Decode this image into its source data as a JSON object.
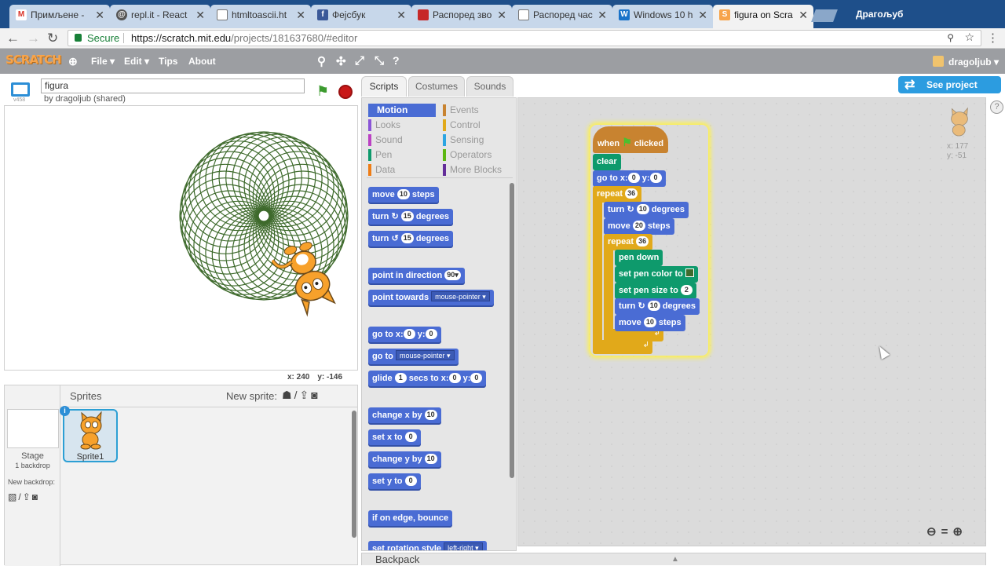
{
  "browser": {
    "tabs": [
      {
        "label": "Примљене - ",
        "icon": "gmail-icon"
      },
      {
        "label": "repl.it - React",
        "icon": "repl-icon"
      },
      {
        "label": "htmltoascii.ht",
        "icon": "document-icon"
      },
      {
        "label": "Фејсбук",
        "icon": "facebook-icon"
      },
      {
        "label": "Распоред зво",
        "icon": "page-icon"
      },
      {
        "label": "Распоред час",
        "icon": "document-icon"
      },
      {
        "label": "Windows 10 h",
        "icon": "windows-icon"
      },
      {
        "label": "figura on Scra",
        "icon": "scratch-icon"
      }
    ],
    "user": "Драгољуб",
    "secure_label": "Secure",
    "url_host": "https://scratch.mit.edu",
    "url_path": "/projects/181637680/#editor"
  },
  "menubar": {
    "logo": "SCRATCH",
    "items": [
      "File ▾",
      "Edit ▾",
      "Tips",
      "About"
    ],
    "user": "dragoljub ▾"
  },
  "stage": {
    "version": "v458",
    "title": "figura",
    "by": "by dragoljub (shared)",
    "mouse_x": "x: 240",
    "mouse_y": "y: -146"
  },
  "sprites_panel": {
    "title": "Sprites",
    "new_sprite": "New sprite:",
    "stage_label": "Stage",
    "backdrops": "1 backdrop",
    "new_backdrop": "New backdrop:",
    "sprite_name": "Sprite1",
    "info": "i"
  },
  "editor": {
    "tabs": [
      "Scripts",
      "Costumes",
      "Sounds"
    ],
    "see_project": "See project page",
    "backpack": "Backpack",
    "help": "?"
  },
  "categories": [
    {
      "label": "Motion",
      "color": "#4a6cd4"
    },
    {
      "label": "Events",
      "color": "#c88330"
    },
    {
      "label": "Looks",
      "color": "#8a55d7"
    },
    {
      "label": "Control",
      "color": "#e1a91a"
    },
    {
      "label": "Sound",
      "color": "#bb42c3"
    },
    {
      "label": "Sensing",
      "color": "#2ca5e2"
    },
    {
      "label": "Pen",
      "color": "#0e9a6c"
    },
    {
      "label": "Operators",
      "color": "#5cb712"
    },
    {
      "label": "Data",
      "color": "#ee7d16"
    },
    {
      "label": "More Blocks",
      "color": "#632d99"
    }
  ],
  "palette_blocks": {
    "move": [
      "move",
      "10",
      "steps"
    ],
    "turn_right": [
      "turn",
      "15",
      "degrees"
    ],
    "turn_left": [
      "turn",
      "15",
      "degrees"
    ],
    "point_direction": [
      "point in direction",
      "90▾"
    ],
    "point_towards": [
      "point towards",
      "mouse-pointer ▾"
    ],
    "go_to_xy": [
      "go to x:",
      "0",
      "y:",
      "0"
    ],
    "go_to": [
      "go to",
      "mouse-pointer ▾"
    ],
    "glide": [
      "glide",
      "1",
      "secs to x:",
      "0",
      "y:",
      "0"
    ],
    "change_x": [
      "change x by",
      "10"
    ],
    "set_x": [
      "set x to",
      "0"
    ],
    "change_y": [
      "change y by",
      "10"
    ],
    "set_y": [
      "set y to",
      "0"
    ],
    "bounce": [
      "if on edge, bounce"
    ],
    "rotation_style": [
      "set rotation style",
      "left-right ▾"
    ]
  },
  "script": {
    "hat": [
      "when",
      "clicked"
    ],
    "clear": "clear",
    "go_to": [
      "go to x:",
      "0",
      "y:",
      "0"
    ],
    "repeat_outer": [
      "repeat",
      "36"
    ],
    "turn1": [
      "turn",
      "10",
      "degrees"
    ],
    "move1": [
      "move",
      "20",
      "steps"
    ],
    "repeat_inner": [
      "repeat",
      "36"
    ],
    "pen_down": "pen down",
    "pen_color": "set pen color to",
    "pen_color_value": "#3f6b2c",
    "pen_size": [
      "set pen size to",
      "2"
    ],
    "turn2": [
      "turn",
      "10",
      "degrees"
    ],
    "move2": [
      "move",
      "10",
      "steps"
    ]
  },
  "sprite_info": {
    "x": "x: 177",
    "y": "y: -51"
  },
  "colors": {
    "spiro": "#3e6a2c",
    "motion": "#4a6cd4",
    "pen": "#0e9a6c",
    "control": "#e1a91a",
    "events": "#c88330"
  }
}
